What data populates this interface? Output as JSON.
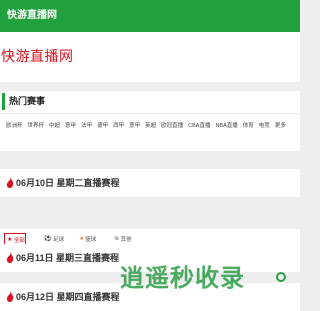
{
  "header": {
    "site_name": "快游直播网"
  },
  "logo": {
    "text": "快游直播网"
  },
  "hot_section": {
    "title": "热门赛事",
    "links": [
      "欧洲杯",
      "世界杯",
      "中超",
      "意甲",
      "法甲",
      "德甲",
      "西甲",
      "意甲",
      "英超",
      "欧冠直播",
      "CBA直播",
      "NBA直播",
      "体育",
      "电竞",
      "更多"
    ]
  },
  "days": [
    {
      "title": "06月10日 星期二直播赛程"
    },
    {
      "title": "06月11日 星期三直播赛程"
    },
    {
      "title": "06月12日 星期四直播赛程"
    }
  ],
  "tabs": {
    "all": "全部",
    "football": "足球",
    "basketball": "篮球",
    "other": "其他"
  },
  "watermark": {
    "text": "逍遥秒收录"
  },
  "colors": {
    "brand": "#21a13d",
    "accent": "#d8121f"
  }
}
